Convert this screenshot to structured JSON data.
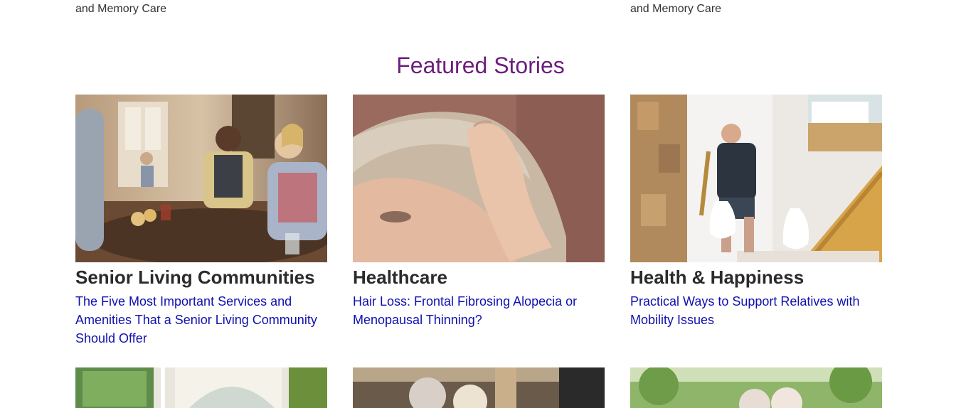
{
  "top_fragments": {
    "left": "and Memory Care",
    "right": "and Memory Care"
  },
  "featured": {
    "title": "Featured Stories",
    "title_color": "#6b1f7b",
    "link_color": "#1010b0",
    "cards": [
      {
        "category": "Senior Living Communities",
        "headline": "The Five Most Important Services and Amenities That a Senior Living Community Should Offer",
        "image": "seniors-playing-cards-photo"
      },
      {
        "category": "Healthcare",
        "headline": "Hair Loss: Frontal Fibrosing Alopecia or Menopausal Thinning?",
        "image": "woman-touching-hair-photo"
      },
      {
        "category": "Health & Happiness",
        "headline": "Practical Ways to Support Relatives with Mobility Issues",
        "image": "man-climbing-stairs-photo"
      }
    ],
    "next_row_images": [
      "sunroom-photo",
      "seniors-dining-photo",
      "seniors-outdoors-photo"
    ]
  }
}
